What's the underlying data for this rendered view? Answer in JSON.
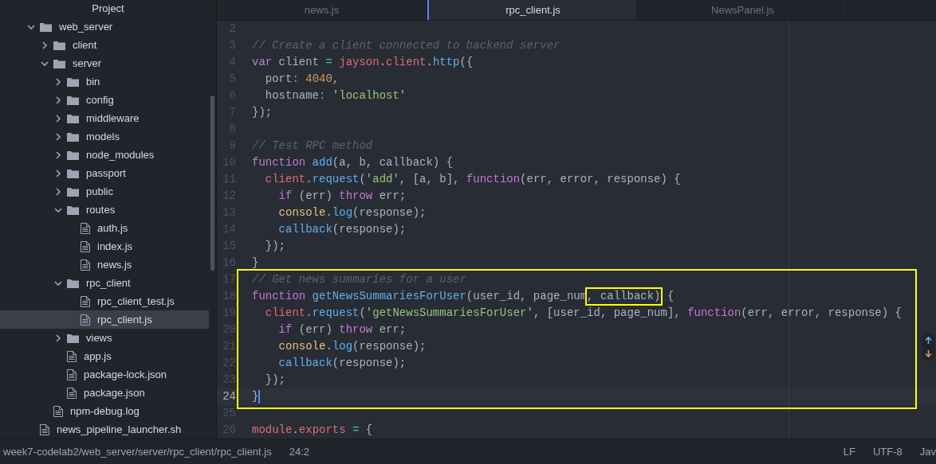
{
  "sidebar": {
    "title": "Project",
    "tree": [
      {
        "name": "web_server",
        "kind": "folder",
        "expanded": true,
        "selected": false,
        "children": [
          {
            "name": "client",
            "kind": "folder",
            "expanded": false,
            "selected": false
          },
          {
            "name": "server",
            "kind": "folder",
            "expanded": true,
            "selected": false,
            "children": [
              {
                "name": "bin",
                "kind": "folder",
                "expanded": false,
                "selected": false
              },
              {
                "name": "config",
                "kind": "folder",
                "expanded": false,
                "selected": false
              },
              {
                "name": "middleware",
                "kind": "folder",
                "expanded": false,
                "selected": false
              },
              {
                "name": "models",
                "kind": "folder",
                "expanded": false,
                "selected": false
              },
              {
                "name": "node_modules",
                "kind": "folder",
                "expanded": false,
                "selected": false
              },
              {
                "name": "passport",
                "kind": "folder",
                "expanded": false,
                "selected": false
              },
              {
                "name": "public",
                "kind": "folder",
                "expanded": false,
                "selected": false
              },
              {
                "name": "routes",
                "kind": "folder",
                "expanded": true,
                "selected": false,
                "children": [
                  {
                    "name": "auth.js",
                    "kind": "file",
                    "selected": false
                  },
                  {
                    "name": "index.js",
                    "kind": "file",
                    "selected": false
                  },
                  {
                    "name": "news.js",
                    "kind": "file",
                    "selected": false
                  }
                ]
              },
              {
                "name": "rpc_client",
                "kind": "folder",
                "expanded": true,
                "selected": false,
                "children": [
                  {
                    "name": "rpc_client_test.js",
                    "kind": "file",
                    "selected": false
                  },
                  {
                    "name": "rpc_client.js",
                    "kind": "file",
                    "selected": true
                  }
                ]
              },
              {
                "name": "views",
                "kind": "folder",
                "expanded": false,
                "selected": false
              },
              {
                "name": "app.js",
                "kind": "file",
                "selected": false
              },
              {
                "name": "package-lock.json",
                "kind": "file",
                "selected": false
              },
              {
                "name": "package.json",
                "kind": "file",
                "selected": false
              }
            ]
          },
          {
            "name": "npm-debug.log",
            "kind": "file",
            "selected": false
          }
        ]
      },
      {
        "name": "news_pipeline_launcher.sh",
        "kind": "file",
        "selected": false
      }
    ]
  },
  "tabs": [
    {
      "label": "news.js",
      "selected": false
    },
    {
      "label": "rpc_client.js",
      "selected": true
    },
    {
      "label": "NewsPanel.js",
      "selected": false
    }
  ],
  "editor": {
    "lines": [
      {
        "number": "2",
        "current": false
      },
      {
        "number": "3",
        "current": false,
        "tokens": [
          {
            "kind": "comment",
            "text": "// Create a client connected to backend server"
          }
        ]
      },
      {
        "number": "4",
        "current": false,
        "tokens": [
          {
            "kind": "keyword",
            "text": "var"
          },
          {
            "kind": "plain",
            "text": " client "
          },
          {
            "kind": "operator",
            "text": "="
          },
          {
            "kind": "variable",
            "text": " jayson"
          },
          {
            "kind": "plain",
            "text": "."
          },
          {
            "kind": "variable",
            "text": "client"
          },
          {
            "kind": "plain",
            "text": "."
          },
          {
            "kind": "function",
            "text": "http"
          },
          {
            "kind": "plain",
            "text": "({"
          }
        ]
      },
      {
        "number": "5",
        "current": false,
        "tokens": [
          {
            "kind": "plain",
            "text": "  port"
          },
          {
            "kind": "operator",
            "text": ":"
          },
          {
            "kind": "number",
            "text": " 4040"
          },
          {
            "kind": "plain",
            "text": ","
          }
        ]
      },
      {
        "number": "6",
        "current": false,
        "tokens": [
          {
            "kind": "plain",
            "text": "  hostname"
          },
          {
            "kind": "operator",
            "text": ":"
          },
          {
            "kind": "string",
            "text": " 'localhost'"
          }
        ]
      },
      {
        "number": "7",
        "current": false,
        "tokens": [
          {
            "kind": "plain",
            "text": "});"
          }
        ]
      },
      {
        "number": "8",
        "current": false
      },
      {
        "number": "9",
        "current": false,
        "tokens": [
          {
            "kind": "comment",
            "text": "// Test RPC method"
          }
        ]
      },
      {
        "number": "10",
        "current": false,
        "tokens": [
          {
            "kind": "keyword",
            "text": "function"
          },
          {
            "kind": "function",
            "text": " add"
          },
          {
            "kind": "plain",
            "text": "(a, b, callback) {"
          }
        ]
      },
      {
        "number": "11",
        "current": false,
        "tokens": [
          {
            "kind": "variable",
            "text": "  client"
          },
          {
            "kind": "plain",
            "text": "."
          },
          {
            "kind": "function",
            "text": "request"
          },
          {
            "kind": "plain",
            "text": "("
          },
          {
            "kind": "string",
            "text": "'add'"
          },
          {
            "kind": "plain",
            "text": ", [a, b], "
          },
          {
            "kind": "keyword",
            "text": "function"
          },
          {
            "kind": "plain",
            "text": "(err, error, response) {"
          }
        ]
      },
      {
        "number": "12",
        "current": false,
        "tokens": [
          {
            "kind": "keyword",
            "text": "    if"
          },
          {
            "kind": "plain",
            "text": " (err) "
          },
          {
            "kind": "keyword",
            "text": "throw"
          },
          {
            "kind": "plain",
            "text": " err;"
          }
        ]
      },
      {
        "number": "13",
        "current": false,
        "tokens": [
          {
            "kind": "builtin",
            "text": "    console"
          },
          {
            "kind": "plain",
            "text": "."
          },
          {
            "kind": "function",
            "text": "log"
          },
          {
            "kind": "plain",
            "text": "(response);"
          }
        ]
      },
      {
        "number": "14",
        "current": false,
        "tokens": [
          {
            "kind": "function",
            "text": "    callback"
          },
          {
            "kind": "plain",
            "text": "(response);"
          }
        ]
      },
      {
        "number": "15",
        "current": false,
        "tokens": [
          {
            "kind": "plain",
            "text": "  });"
          }
        ]
      },
      {
        "number": "16",
        "current": false,
        "tokens": [
          {
            "kind": "plain",
            "text": "}"
          }
        ]
      },
      {
        "number": "17",
        "current": false,
        "tokens": [
          {
            "kind": "comment",
            "text": "// Get news summaries for a user"
          }
        ]
      },
      {
        "number": "18",
        "current": false,
        "tokens": [
          {
            "kind": "keyword",
            "text": "function",
            "framed": false
          },
          {
            "kind": "function",
            "text": " getNewsSummariesForUser",
            "framed": false
          },
          {
            "kind": "plain",
            "text": "(user_id, page_num",
            "framed": false
          },
          {
            "kind": "plain",
            "text": ", callback)",
            "framed": true
          },
          {
            "kind": "plain",
            "text": " {",
            "framed": false
          }
        ]
      },
      {
        "number": "19",
        "current": false,
        "tokens": [
          {
            "kind": "variable",
            "text": "  client"
          },
          {
            "kind": "plain",
            "text": "."
          },
          {
            "kind": "function",
            "text": "request"
          },
          {
            "kind": "plain",
            "text": "("
          },
          {
            "kind": "string",
            "text": "'getNewsSummariesForUser'"
          },
          {
            "kind": "plain",
            "text": ", [user_id, page_num], "
          },
          {
            "kind": "keyword",
            "text": "function"
          },
          {
            "kind": "plain",
            "text": "(err, error, response) {"
          }
        ]
      },
      {
        "number": "20",
        "current": false,
        "tokens": [
          {
            "kind": "keyword",
            "text": "    if"
          },
          {
            "kind": "plain",
            "text": " (err) "
          },
          {
            "kind": "keyword",
            "text": "throw"
          },
          {
            "kind": "plain",
            "text": " err;"
          }
        ]
      },
      {
        "number": "21",
        "current": false,
        "tokens": [
          {
            "kind": "builtin",
            "text": "    console"
          },
          {
            "kind": "plain",
            "text": "."
          },
          {
            "kind": "function",
            "text": "log"
          },
          {
            "kind": "plain",
            "text": "(response);"
          }
        ]
      },
      {
        "number": "22",
        "current": false,
        "tokens": [
          {
            "kind": "function",
            "text": "    callback"
          },
          {
            "kind": "plain",
            "text": "(response);"
          }
        ]
      },
      {
        "number": "23",
        "current": false,
        "tokens": [
          {
            "kind": "plain",
            "text": "  });"
          }
        ]
      },
      {
        "number": "24",
        "current": true,
        "tokens": [
          {
            "kind": "plain",
            "text": "}"
          }
        ]
      },
      {
        "number": "25",
        "current": false
      },
      {
        "number": "26",
        "current": false,
        "tokens": [
          {
            "kind": "variable",
            "text": "module"
          },
          {
            "kind": "plain",
            "text": "."
          },
          {
            "kind": "variable",
            "text": "exports"
          },
          {
            "kind": "operator",
            "text": " ="
          },
          {
            "kind": "plain",
            "text": " {"
          }
        ]
      }
    ]
  },
  "status_bar": {
    "path": "week7-codelab2/web_server/server/rpc_client/rpc_client.js",
    "position": "24:2",
    "line_ending": "LF",
    "encoding": "UTF-8",
    "grammar": "Jav"
  }
}
